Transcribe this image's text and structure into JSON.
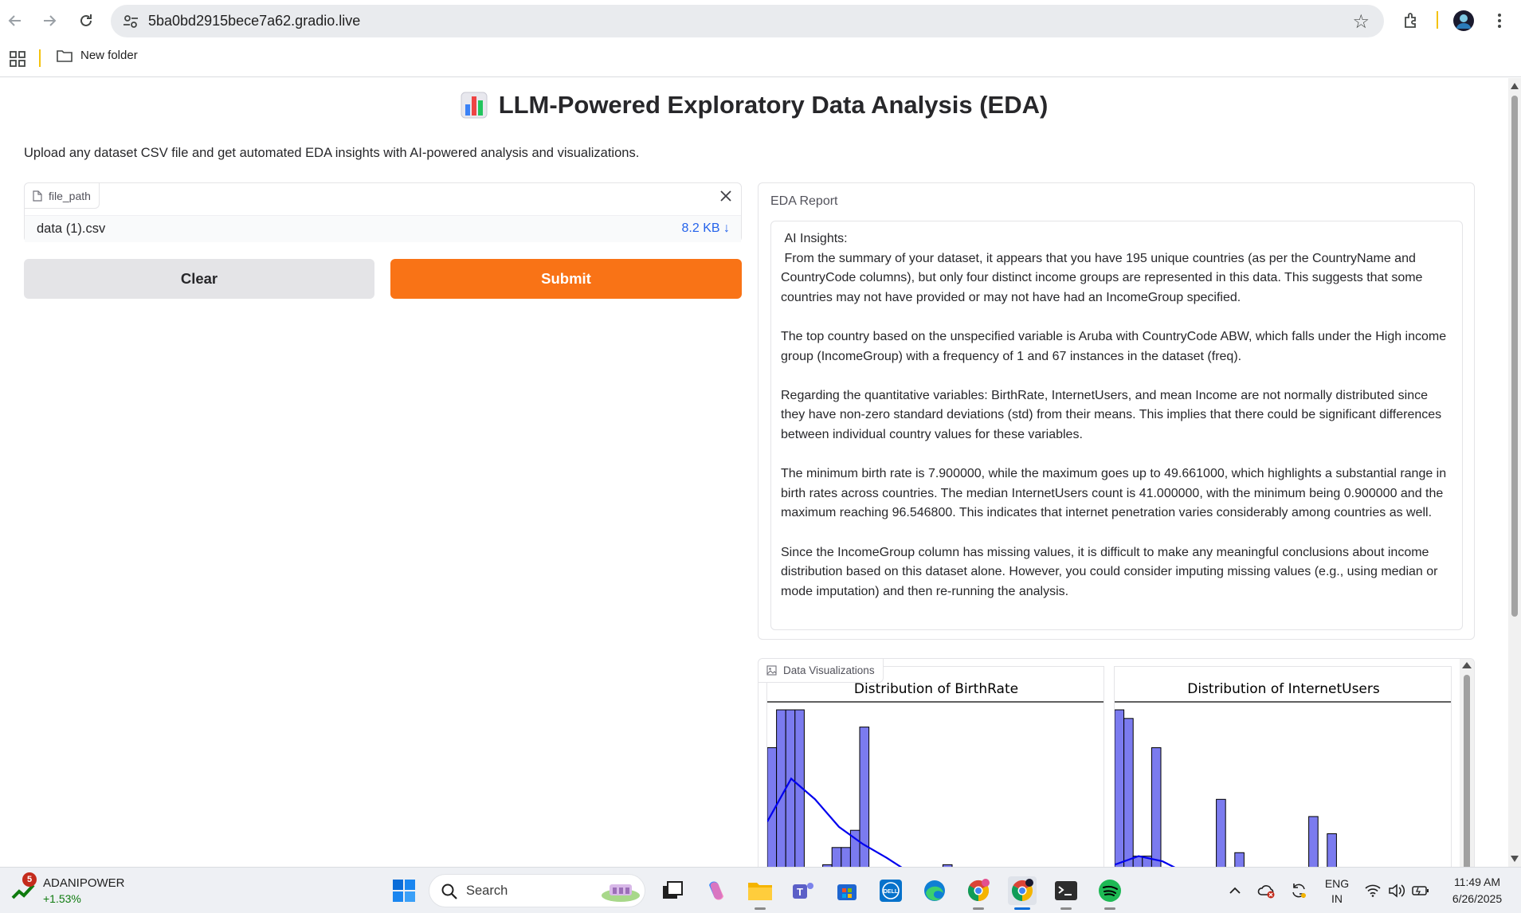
{
  "browser": {
    "url": "5ba0bd2915bece7a62.gradio.live",
    "bookmark_folder": "New folder"
  },
  "page": {
    "title": "LLM-Powered Exploratory Data Analysis (EDA)",
    "description": "Upload any dataset CSV file and get automated EDA insights with AI-powered analysis and visualizations.",
    "file_input": {
      "label": "file_path",
      "file_name": "data (1).csv",
      "file_size": "8.2 KB ↓"
    },
    "clear_label": "Clear",
    "submit_label": "Submit",
    "report": {
      "label": "EDA Report",
      "text": " AI Insights:\n From the summary of your dataset, it appears that you have 195 unique countries (as per the CountryName and CountryCode columns), but only four distinct income groups are represented in this data. This suggests that some countries may not have provided or may not have had an IncomeGroup specified.\n\nThe top country based on the unspecified variable is Aruba with CountryCode ABW, which falls under the High income group (IncomeGroup) with a frequency of 1 and 67 instances in the dataset (freq).\n\nRegarding the quantitative variables: BirthRate, InternetUsers, and mean Income are not normally distributed since they have non-zero standard deviations (std) from their means. This implies that there could be significant differences between individual country values for these variables.\n\nThe minimum birth rate is 7.900000, while the maximum goes up to 49.661000, which highlights a substantial range in birth rates across countries. The median InternetUsers count is 41.000000, with the minimum being 0.900000 and the maximum reaching 96.546800. This indicates that internet penetration varies considerably among countries as well.\n\nSince the IncomeGroup column has missing values, it is difficult to make any meaningful conclusions about income distribution based on this dataset alone. However, you could consider imputing missing values (e.g., using median or mode imputation) and then re-running the analysis."
    },
    "gallery": {
      "label": "Data Visualizations",
      "charts": [
        {
          "title": "Distribution of BirthRate",
          "bar_color": "#7b7bef",
          "kde_color": "#0000ee",
          "bars": [
            0.78,
            1.0,
            1.0,
            1.0,
            0,
            0,
            0.1,
            0.2,
            0.2,
            0.3,
            0.9,
            0,
            0,
            0,
            0,
            0,
            0,
            0,
            0,
            0.1,
            0
          ],
          "kde": [
            0.35,
            0.6,
            0.48,
            0.32,
            0.22,
            0.14,
            0.05,
            0,
            0,
            0,
            0,
            0
          ]
        },
        {
          "title": "Distribution of InternetUsers",
          "bar_color": "#7b7bef",
          "kde_color": "#0000ee",
          "bars": [
            1.0,
            0.95,
            0.15,
            0.15,
            0.78,
            0,
            0,
            0,
            0,
            0,
            0,
            0.48,
            0,
            0.17,
            0.05,
            0,
            0,
            0,
            0,
            0,
            0,
            0.38,
            0,
            0.28,
            0
          ],
          "kde": [
            0.1,
            0.15,
            0.12,
            0.05,
            0,
            0,
            0,
            0,
            0,
            0,
            0,
            0
          ]
        }
      ]
    }
  },
  "taskbar": {
    "stock_name": "ADANIPOWER",
    "stock_change": "+1.53%",
    "stock_badge": "5",
    "search_placeholder": "Search",
    "language": "ENG",
    "region": "IN",
    "time": "11:49 AM",
    "date": "6/26/2025"
  }
}
